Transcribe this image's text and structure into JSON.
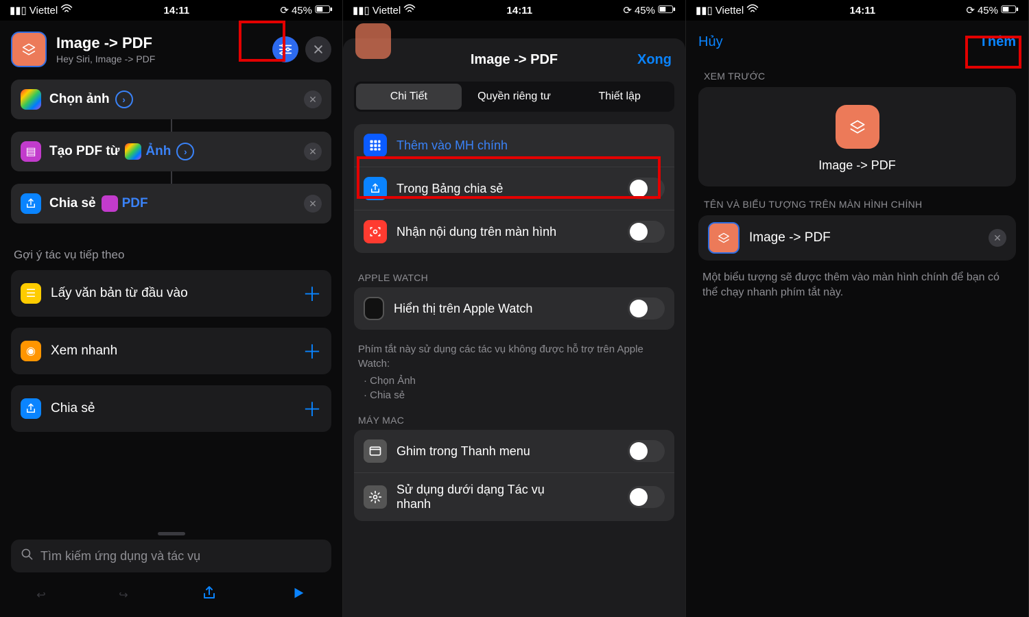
{
  "status": {
    "carrier": "Viettel",
    "time": "14:11",
    "battery": "45%"
  },
  "pane1": {
    "title": "Image -> PDF",
    "subtitle": "Hey Siri, Image -> PDF",
    "actions": {
      "select_photos": "Chọn ảnh",
      "make_pdf_prefix": "Tạo PDF từ",
      "make_pdf_var": "Ảnh",
      "share_prefix": "Chia sẻ",
      "share_var": "PDF"
    },
    "suggestions_header": "Gợi ý tác vụ tiếp theo",
    "suggestions": {
      "get_text": "Lấy văn bản từ đầu vào",
      "quick_look": "Xem nhanh",
      "share": "Chia sẻ"
    },
    "search_placeholder": "Tìm kiếm ứng dụng và tác vụ"
  },
  "pane2": {
    "title": "Image -> PDF",
    "done": "Xong",
    "segments": {
      "details": "Chi Tiết",
      "privacy": "Quyền riêng tư",
      "setup": "Thiết lập"
    },
    "rows": {
      "add_home": "Thêm vào MH chính",
      "share_sheet": "Trong Bảng chia sẻ",
      "receive_screen": "Nhận nội dung trên màn hình"
    },
    "aw_header": "APPLE WATCH",
    "aw_row": "Hiển thị trên Apple Watch",
    "aw_note_intro": "Phím tắt này sử dụng các tác vụ không được hỗ trợ trên Apple Watch:",
    "aw_note_b1": "Chọn Ảnh",
    "aw_note_b2": "Chia sẻ",
    "mac_header": "MÁY MAC",
    "mac_pin": "Ghim trong Thanh menu",
    "mac_quick": "Sử dụng dưới dạng Tác vụ nhanh"
  },
  "pane3": {
    "cancel": "Hủy",
    "add": "Thêm",
    "preview_header": "XEM TRƯỚC",
    "preview_label": "Image -> PDF",
    "name_header": "TÊN VÀ BIỂU TƯỢNG TRÊN MÀN HÌNH CHÍNH",
    "name_value": "Image -> PDF",
    "note": "Một biểu tượng sẽ được thêm vào màn hình chính để bạn có thể chạy nhanh phím tắt này."
  }
}
